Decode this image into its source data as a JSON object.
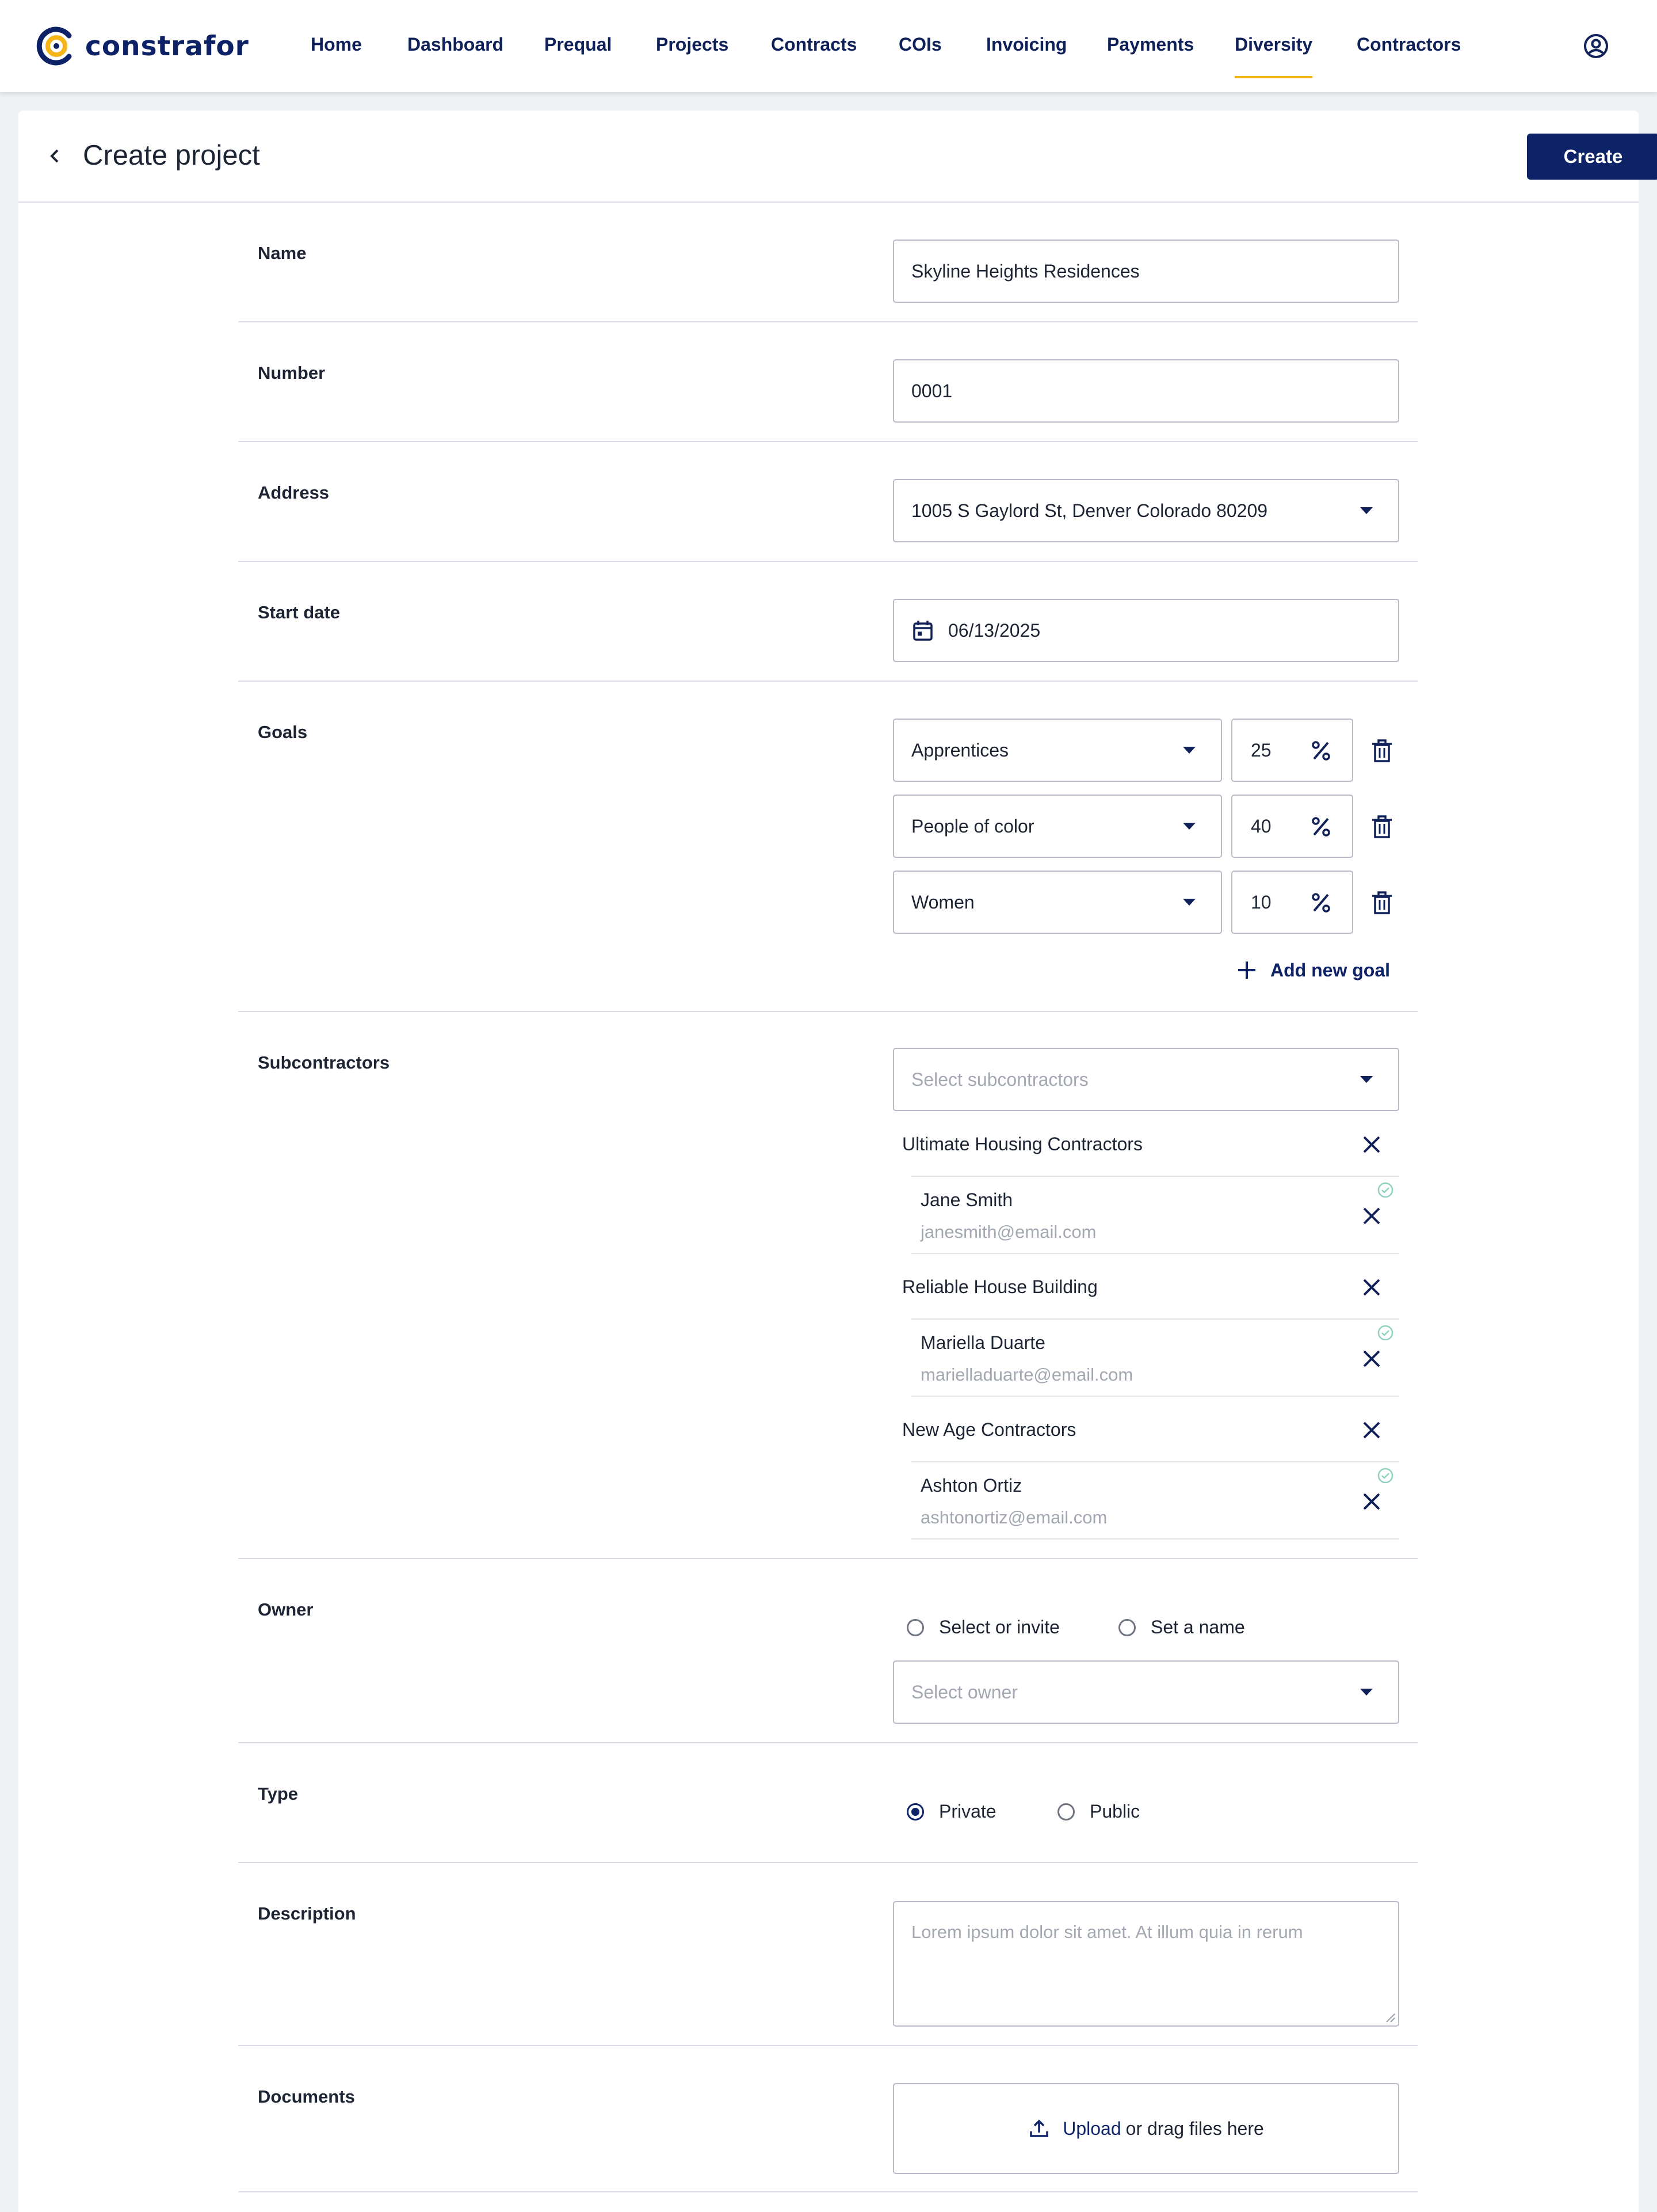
{
  "brand": {
    "name": "constrafor",
    "accent": "#f5b417",
    "primary": "#0e2367"
  },
  "nav": {
    "items": [
      {
        "label": "Home"
      },
      {
        "label": "Dashboard"
      },
      {
        "label": "Prequal"
      },
      {
        "label": "Projects"
      },
      {
        "label": "Contracts"
      },
      {
        "label": "COIs"
      },
      {
        "label": "Invoicing"
      },
      {
        "label": "Payments"
      },
      {
        "label": "Diversity",
        "active": true
      },
      {
        "label": "Contractors"
      }
    ],
    "profile_icon": "user-circle-icon"
  },
  "header": {
    "title": "Create project",
    "create_label": "Create",
    "back_icon": "chevron-left-icon"
  },
  "form": {
    "name": {
      "label": "Name",
      "value": "Skyline Heights Residences"
    },
    "number": {
      "label": "Number",
      "value": "0001"
    },
    "address": {
      "label": "Address",
      "value": "1005 S Gaylord St, Denver Colorado 80209"
    },
    "start_date": {
      "label": "Start date",
      "value": "06/13/2025",
      "icon": "calendar-icon"
    },
    "goals": {
      "label": "Goals",
      "items": [
        {
          "category": "Apprentices",
          "percent": "25"
        },
        {
          "category": "People of color",
          "percent": "40"
        },
        {
          "category": "Women",
          "percent": "10"
        }
      ],
      "add_label": "Add new goal"
    },
    "subcontractors": {
      "label": "Subcontractors",
      "placeholder": "Select subcontractors",
      "items": [
        {
          "company": "Ultimate Housing Contractors",
          "contact_name": "Jane Smith",
          "contact_email": "janesmith@email.com"
        },
        {
          "company": "Reliable House Building",
          "contact_name": "Mariella Duarte",
          "contact_email": "marielladuarte@email.com"
        },
        {
          "company": "New Age Contractors",
          "contact_name": "Ashton Ortiz",
          "contact_email": "ashtonortiz@email.com"
        }
      ]
    },
    "owner": {
      "label": "Owner",
      "options": [
        "Select or invite",
        "Set a name"
      ],
      "placeholder": "Select owner"
    },
    "type": {
      "label": "Type",
      "options": [
        "Private",
        "Public"
      ],
      "selected": "Private"
    },
    "description": {
      "label": "Description",
      "placeholder": "Lorem ipsum dolor sit amet. At illum quia in rerum"
    },
    "documents": {
      "label": "Documents",
      "upload_link": "Upload",
      "upload_text": "or drag files here"
    }
  }
}
